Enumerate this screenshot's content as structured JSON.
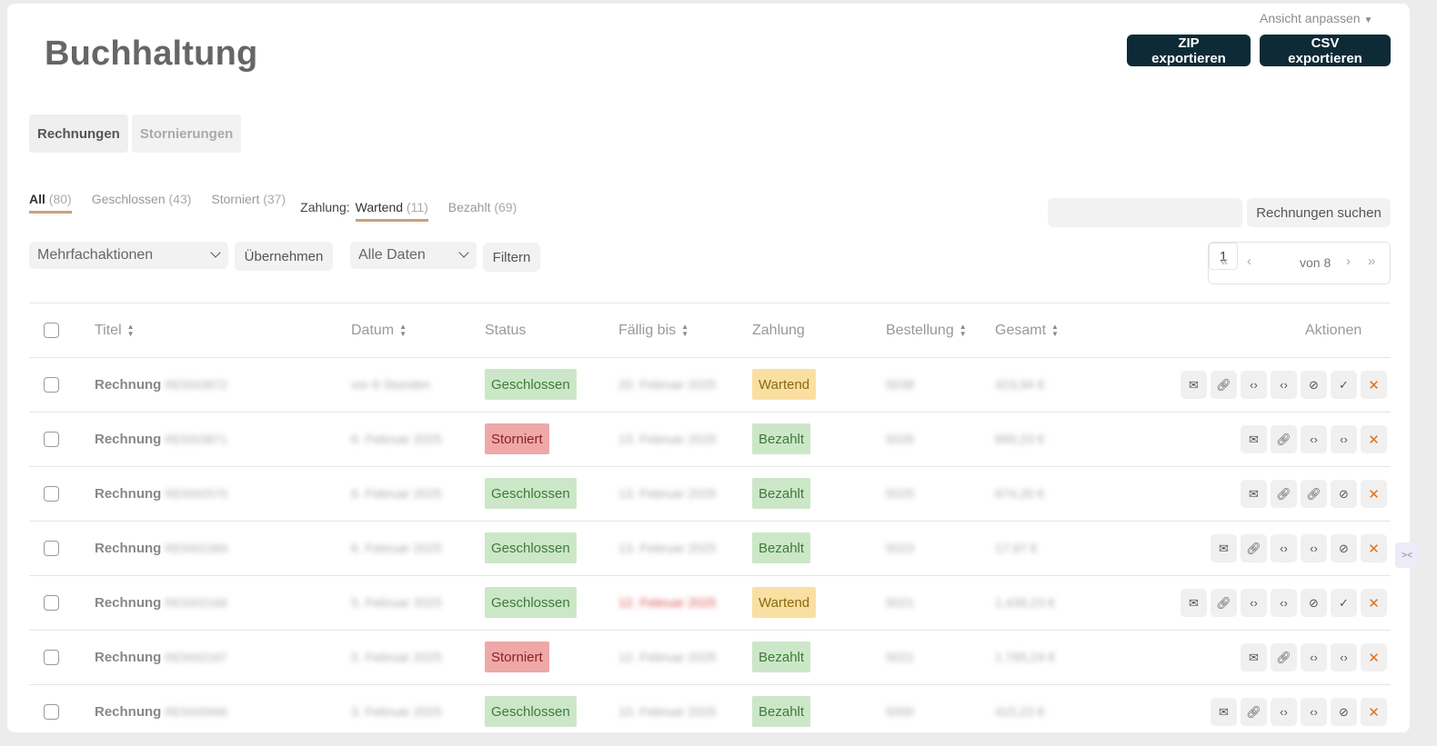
{
  "screen_options": "Ansicht anpassen",
  "page_title": "Buchhaltung",
  "header_buttons": {
    "zip": "ZIP exportieren",
    "csv": "CSV exportieren"
  },
  "tabs": [
    {
      "label": "Rechnungen"
    },
    {
      "label": "Stornierungen"
    }
  ],
  "status_filters": [
    {
      "label": "All",
      "count": "(80)"
    },
    {
      "label": "Geschlossen",
      "count": "(43)"
    },
    {
      "label": "Storniert",
      "count": "(37)"
    }
  ],
  "payment_filter": {
    "label": "Zahlung:",
    "items": [
      {
        "label": "Wartend",
        "count": "(11)"
      },
      {
        "label": "Bezahlt",
        "count": "(69)"
      }
    ]
  },
  "search": {
    "value": "",
    "button": "Rechnungen suchen"
  },
  "bulk": {
    "select": "Mehrfachaktionen",
    "apply": "Übernehmen"
  },
  "date_filter": {
    "select": "Alle Daten",
    "button": "Filtern"
  },
  "pagination": {
    "first": "«",
    "prev": "‹",
    "current": "1",
    "of": "von 8",
    "next": "›",
    "last": "»"
  },
  "columns": {
    "title": "Titel",
    "date": "Datum",
    "status": "Status",
    "due": "Fällig bis",
    "payment": "Zahlung",
    "order": "Bestellung",
    "total": "Gesamt",
    "actions": "Aktionen"
  },
  "rows": [
    {
      "title": "Rechnung",
      "number": "RE5003872",
      "date": "vor 8 Stunden",
      "status": "Geschlossen",
      "due": "20. Februar 2025",
      "payment": "Wartend",
      "order": "5038",
      "total": "423,94 €",
      "actions": [
        "mail-icon",
        "link-icon",
        "code-icon",
        "code-icon",
        "cancel-icon",
        "check-icon",
        "x-icon"
      ]
    },
    {
      "title": "Rechnung",
      "number": "RE5003871",
      "date": "6. Februar 2025",
      "status": "Storniert",
      "due": "13. Februar 2025",
      "payment": "Bezahlt",
      "order": "5026",
      "total": "899,23 €",
      "actions": [
        "mail-icon",
        "link-icon",
        "code-icon",
        "code-icon",
        "x-icon"
      ]
    },
    {
      "title": "Rechnung",
      "number": "RE5002570",
      "date": "6. Februar 2025",
      "status": "Geschlossen",
      "due": "13. Februar 2025",
      "payment": "Bezahlt",
      "order": "5025",
      "total": "674,20 €",
      "actions": [
        "mail-icon",
        "link-icon",
        "link-icon",
        "cancel-icon",
        "x-icon"
      ]
    },
    {
      "title": "Rechnung",
      "number": "RE5002369",
      "date": "6. Februar 2025",
      "status": "Geschlossen",
      "due": "13. Februar 2025",
      "payment": "Bezahlt",
      "order": "5023",
      "total": "17,97 €",
      "actions": [
        "mail-icon",
        "link-icon",
        "code-icon",
        "code-icon",
        "cancel-icon",
        "x-icon"
      ]
    },
    {
      "title": "Rechnung",
      "number": "RE5002168",
      "date": "5. Februar 2025",
      "status": "Geschlossen",
      "due": "12. Februar 2025",
      "due_overdue": true,
      "payment": "Wartend",
      "order": "5021",
      "total": "1.439,23 €",
      "actions": [
        "mail-icon",
        "link-icon",
        "code-icon",
        "code-icon",
        "cancel-icon",
        "check-icon",
        "x-icon"
      ]
    },
    {
      "title": "Rechnung",
      "number": "RE5002167",
      "date": "5. Februar 2025",
      "status": "Storniert",
      "due": "12. Februar 2025",
      "payment": "Bezahlt",
      "order": "5021",
      "total": "1.795,24 €",
      "actions": [
        "mail-icon",
        "link-icon",
        "code-icon",
        "code-icon",
        "x-icon"
      ]
    },
    {
      "title": "Rechnung",
      "number": "RE5000066",
      "date": "3. Februar 2025",
      "status": "Geschlossen",
      "due": "10. Februar 2025",
      "payment": "Bezahlt",
      "order": "5000",
      "total": "415,23 €",
      "actions": [
        "mail-icon",
        "link-icon",
        "code-icon",
        "code-icon",
        "cancel-icon",
        "x-icon"
      ]
    }
  ],
  "colors": {
    "primary": "#0e2a36",
    "accent": "#c8a27a",
    "closed": "#cce7c8",
    "cancelled": "#efa8a8",
    "waiting": "#f9dfa1"
  }
}
